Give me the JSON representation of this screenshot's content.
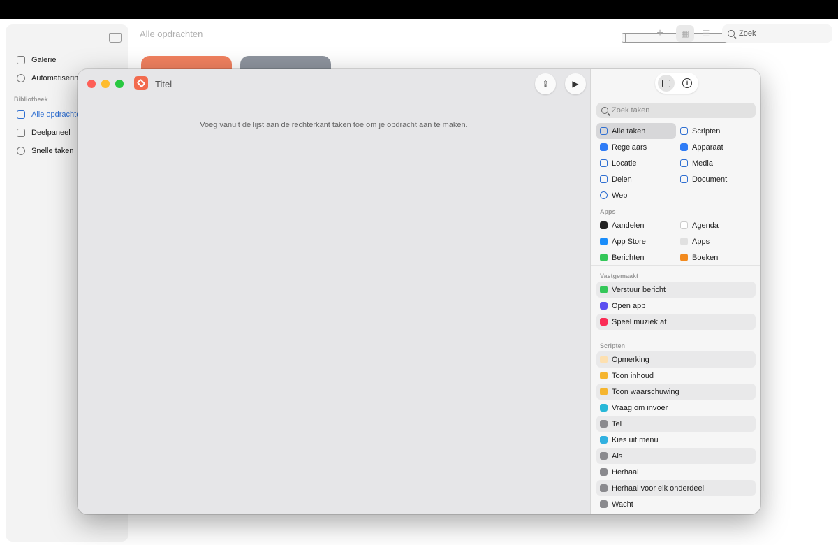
{
  "background": {
    "title": "Alle opdrachten",
    "sidebar": {
      "items": [
        {
          "label": "Galerie",
          "icon": "gallery-icon"
        },
        {
          "label": "Automatisering",
          "icon": "automation-icon"
        }
      ],
      "section_label": "Bibliotheek",
      "library_items": [
        {
          "label": "Alle opdrachten",
          "icon": "shortcuts-icon",
          "active": true
        },
        {
          "label": "Deelpaneel",
          "icon": "share-sheet-icon"
        },
        {
          "label": "Snelle taken",
          "icon": "gear-icon"
        }
      ]
    },
    "toolbar": {
      "add_glyph": "+",
      "grid_glyph": "▦",
      "list_glyph": "☰"
    },
    "search": {
      "placeholder": "Zoek"
    }
  },
  "editor": {
    "title": "Titel",
    "hint": "Voeg vanuit de lijst aan de rechterkant taken toe om je opdracht aan te maken.",
    "share_glyph": "⇪",
    "play_glyph": "▶"
  },
  "panel": {
    "search_placeholder": "Zoek taken",
    "info_glyph": "i",
    "categories": [
      {
        "label": "Alle taken",
        "icon": "list-icon",
        "selected": true
      },
      {
        "label": "Scripten",
        "icon": "scripting-icon"
      },
      {
        "label": "Regelaars",
        "icon": "controls-icon"
      },
      {
        "label": "Apparaat",
        "icon": "device-icon"
      },
      {
        "label": "Locatie",
        "icon": "location-icon"
      },
      {
        "label": "Media",
        "icon": "music-note-icon"
      },
      {
        "label": "Delen",
        "icon": "share-icon"
      },
      {
        "label": "Document",
        "icon": "document-icon"
      },
      {
        "label": "Web",
        "icon": "compass-icon"
      }
    ],
    "apps_label": "Apps",
    "apps": [
      {
        "label": "Aandelen",
        "icon": "stocks-icon"
      },
      {
        "label": "Agenda",
        "icon": "calendar-icon"
      },
      {
        "label": "App Store",
        "icon": "app-store-icon"
      },
      {
        "label": "Apps",
        "icon": "apps-icon"
      },
      {
        "label": "Berichten",
        "icon": "messages-icon"
      },
      {
        "label": "Boeken",
        "icon": "books-icon"
      }
    ],
    "pinned_label": "Vastgemaakt",
    "pinned": [
      {
        "label": "Verstuur bericht",
        "icon": "messages-icon"
      },
      {
        "label": "Open app",
        "icon": "open-app-icon"
      },
      {
        "label": "Speel muziek af",
        "icon": "music-icon"
      }
    ],
    "scripting_label": "Scripten",
    "scripting": [
      {
        "label": "Opmerking",
        "icon": "comment-icon"
      },
      {
        "label": "Toon inhoud",
        "icon": "show-result-icon"
      },
      {
        "label": "Toon waarschuwing",
        "icon": "alert-icon"
      },
      {
        "label": "Vraag om invoer",
        "icon": "ask-input-icon"
      },
      {
        "label": "Tel",
        "icon": "count-icon"
      },
      {
        "label": "Kies uit menu",
        "icon": "menu-icon"
      },
      {
        "label": "Als",
        "icon": "if-icon"
      },
      {
        "label": "Herhaal",
        "icon": "repeat-icon"
      },
      {
        "label": "Herhaal voor elk onderdeel",
        "icon": "repeat-each-icon"
      },
      {
        "label": "Wacht",
        "icon": "wait-icon"
      }
    ]
  }
}
